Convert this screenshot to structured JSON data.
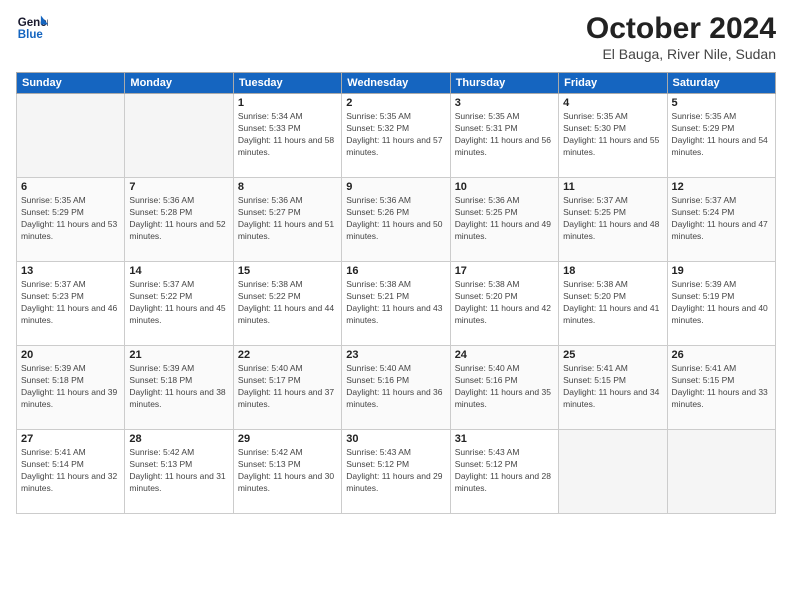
{
  "logo": {
    "line1": "General",
    "line2": "Blue"
  },
  "title": "October 2024",
  "location": "El Bauga, River Nile, Sudan",
  "days_of_week": [
    "Sunday",
    "Monday",
    "Tuesday",
    "Wednesday",
    "Thursday",
    "Friday",
    "Saturday"
  ],
  "weeks": [
    [
      {
        "day": "",
        "info": ""
      },
      {
        "day": "",
        "info": ""
      },
      {
        "day": "1",
        "info": "Sunrise: 5:34 AM\nSunset: 5:33 PM\nDaylight: 11 hours and 58 minutes."
      },
      {
        "day": "2",
        "info": "Sunrise: 5:35 AM\nSunset: 5:32 PM\nDaylight: 11 hours and 57 minutes."
      },
      {
        "day": "3",
        "info": "Sunrise: 5:35 AM\nSunset: 5:31 PM\nDaylight: 11 hours and 56 minutes."
      },
      {
        "day": "4",
        "info": "Sunrise: 5:35 AM\nSunset: 5:30 PM\nDaylight: 11 hours and 55 minutes."
      },
      {
        "day": "5",
        "info": "Sunrise: 5:35 AM\nSunset: 5:29 PM\nDaylight: 11 hours and 54 minutes."
      }
    ],
    [
      {
        "day": "6",
        "info": "Sunrise: 5:35 AM\nSunset: 5:29 PM\nDaylight: 11 hours and 53 minutes."
      },
      {
        "day": "7",
        "info": "Sunrise: 5:36 AM\nSunset: 5:28 PM\nDaylight: 11 hours and 52 minutes."
      },
      {
        "day": "8",
        "info": "Sunrise: 5:36 AM\nSunset: 5:27 PM\nDaylight: 11 hours and 51 minutes."
      },
      {
        "day": "9",
        "info": "Sunrise: 5:36 AM\nSunset: 5:26 PM\nDaylight: 11 hours and 50 minutes."
      },
      {
        "day": "10",
        "info": "Sunrise: 5:36 AM\nSunset: 5:25 PM\nDaylight: 11 hours and 49 minutes."
      },
      {
        "day": "11",
        "info": "Sunrise: 5:37 AM\nSunset: 5:25 PM\nDaylight: 11 hours and 48 minutes."
      },
      {
        "day": "12",
        "info": "Sunrise: 5:37 AM\nSunset: 5:24 PM\nDaylight: 11 hours and 47 minutes."
      }
    ],
    [
      {
        "day": "13",
        "info": "Sunrise: 5:37 AM\nSunset: 5:23 PM\nDaylight: 11 hours and 46 minutes."
      },
      {
        "day": "14",
        "info": "Sunrise: 5:37 AM\nSunset: 5:22 PM\nDaylight: 11 hours and 45 minutes."
      },
      {
        "day": "15",
        "info": "Sunrise: 5:38 AM\nSunset: 5:22 PM\nDaylight: 11 hours and 44 minutes."
      },
      {
        "day": "16",
        "info": "Sunrise: 5:38 AM\nSunset: 5:21 PM\nDaylight: 11 hours and 43 minutes."
      },
      {
        "day": "17",
        "info": "Sunrise: 5:38 AM\nSunset: 5:20 PM\nDaylight: 11 hours and 42 minutes."
      },
      {
        "day": "18",
        "info": "Sunrise: 5:38 AM\nSunset: 5:20 PM\nDaylight: 11 hours and 41 minutes."
      },
      {
        "day": "19",
        "info": "Sunrise: 5:39 AM\nSunset: 5:19 PM\nDaylight: 11 hours and 40 minutes."
      }
    ],
    [
      {
        "day": "20",
        "info": "Sunrise: 5:39 AM\nSunset: 5:18 PM\nDaylight: 11 hours and 39 minutes."
      },
      {
        "day": "21",
        "info": "Sunrise: 5:39 AM\nSunset: 5:18 PM\nDaylight: 11 hours and 38 minutes."
      },
      {
        "day": "22",
        "info": "Sunrise: 5:40 AM\nSunset: 5:17 PM\nDaylight: 11 hours and 37 minutes."
      },
      {
        "day": "23",
        "info": "Sunrise: 5:40 AM\nSunset: 5:16 PM\nDaylight: 11 hours and 36 minutes."
      },
      {
        "day": "24",
        "info": "Sunrise: 5:40 AM\nSunset: 5:16 PM\nDaylight: 11 hours and 35 minutes."
      },
      {
        "day": "25",
        "info": "Sunrise: 5:41 AM\nSunset: 5:15 PM\nDaylight: 11 hours and 34 minutes."
      },
      {
        "day": "26",
        "info": "Sunrise: 5:41 AM\nSunset: 5:15 PM\nDaylight: 11 hours and 33 minutes."
      }
    ],
    [
      {
        "day": "27",
        "info": "Sunrise: 5:41 AM\nSunset: 5:14 PM\nDaylight: 11 hours and 32 minutes."
      },
      {
        "day": "28",
        "info": "Sunrise: 5:42 AM\nSunset: 5:13 PM\nDaylight: 11 hours and 31 minutes."
      },
      {
        "day": "29",
        "info": "Sunrise: 5:42 AM\nSunset: 5:13 PM\nDaylight: 11 hours and 30 minutes."
      },
      {
        "day": "30",
        "info": "Sunrise: 5:43 AM\nSunset: 5:12 PM\nDaylight: 11 hours and 29 minutes."
      },
      {
        "day": "31",
        "info": "Sunrise: 5:43 AM\nSunset: 5:12 PM\nDaylight: 11 hours and 28 minutes."
      },
      {
        "day": "",
        "info": ""
      },
      {
        "day": "",
        "info": ""
      }
    ]
  ]
}
